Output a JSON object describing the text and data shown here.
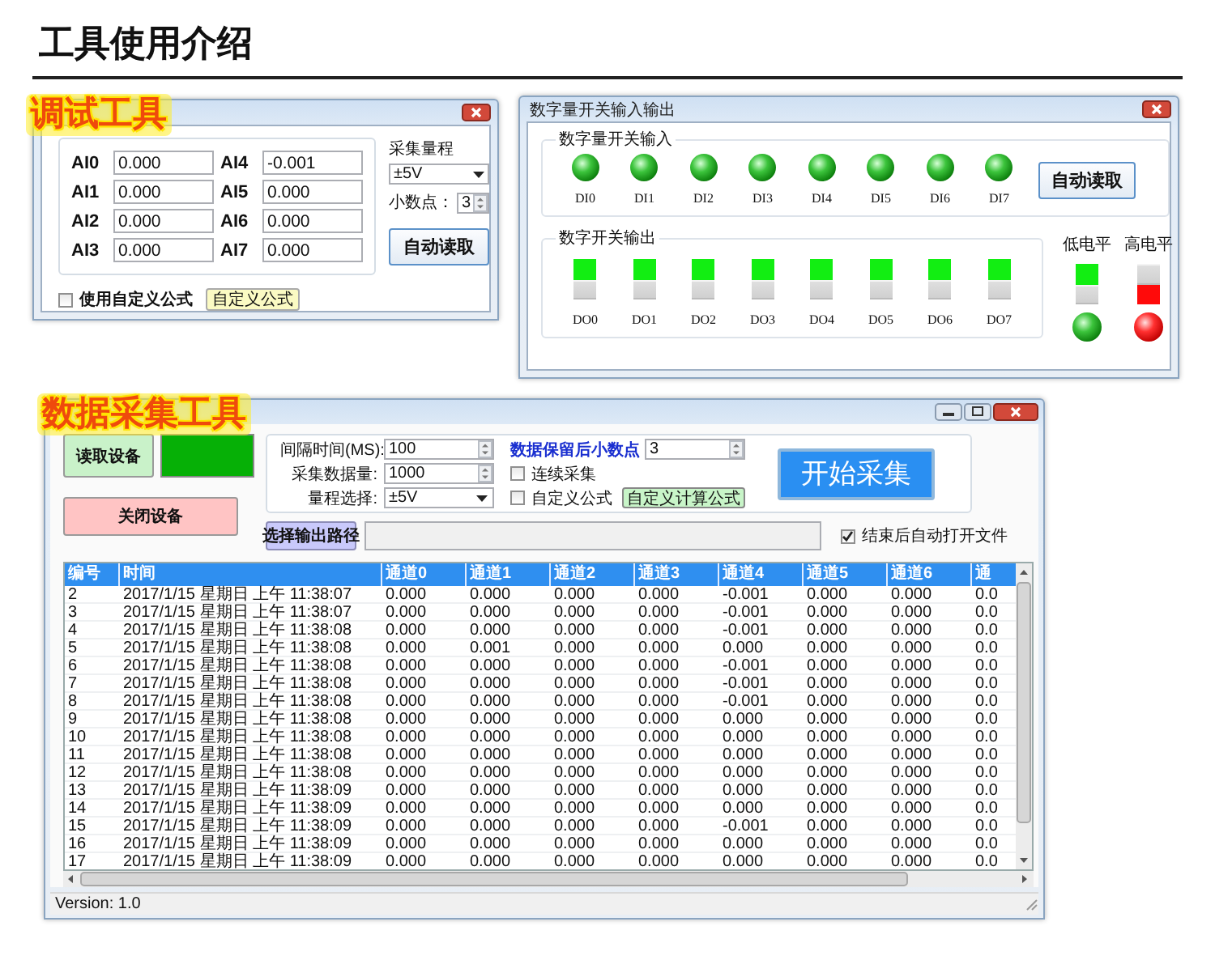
{
  "page_title": "工具使用介绍",
  "debug_tool": {
    "badge": "调试工具",
    "channels": [
      {
        "label": "AI0",
        "value": "0.000"
      },
      {
        "label": "AI4",
        "value": "-0.001"
      },
      {
        "label": "AI1",
        "value": "0.000"
      },
      {
        "label": "AI5",
        "value": "0.000"
      },
      {
        "label": "AI2",
        "value": "0.000"
      },
      {
        "label": "AI6",
        "value": "0.000"
      },
      {
        "label": "AI3",
        "value": "0.000"
      },
      {
        "label": "AI7",
        "value": "0.000"
      }
    ],
    "range": {
      "label": "采集量程",
      "value": "±5V"
    },
    "decimals": {
      "label": "小数点：",
      "value": "3"
    },
    "auto_read_button": "自动读取",
    "custom_formula": {
      "label": "使用自定义公式",
      "checked": false
    },
    "formula_button": "自定义公式"
  },
  "dio_window": {
    "title": "数字量开关输入输出",
    "inputs": {
      "title": "数字量开关输入",
      "channels": [
        {
          "label": "DI0",
          "on": true
        },
        {
          "label": "DI1",
          "on": true
        },
        {
          "label": "DI2",
          "on": true
        },
        {
          "label": "DI3",
          "on": true
        },
        {
          "label": "DI4",
          "on": true
        },
        {
          "label": "DI5",
          "on": true
        },
        {
          "label": "DI6",
          "on": true
        },
        {
          "label": "DI7",
          "on": true
        }
      ]
    },
    "auto_read_button": "自动读取",
    "outputs": {
      "title": "数字开关输出",
      "channels": [
        {
          "label": "DO0",
          "high": false
        },
        {
          "label": "DO1",
          "high": false
        },
        {
          "label": "DO2",
          "high": false
        },
        {
          "label": "DO3",
          "high": false
        },
        {
          "label": "DO4",
          "high": false
        },
        {
          "label": "DO5",
          "high": false
        },
        {
          "label": "DO6",
          "high": false
        },
        {
          "label": "DO7",
          "high": false
        }
      ]
    },
    "legend": [
      {
        "label": "低电平",
        "high": false
      },
      {
        "label": "高电平",
        "high": true
      }
    ]
  },
  "daq_tool": {
    "badge": "数据采集工具",
    "open_button": "读取设备",
    "device_connected": true,
    "close_button": "关闭设备",
    "interval": {
      "label": "间隔时间(MS):",
      "value": "100"
    },
    "count": {
      "label": "采集数据量:",
      "value": "1000"
    },
    "range": {
      "label": "量程选择:",
      "value": "±5V"
    },
    "decimals": {
      "label": "数据保留后小数点",
      "value": "3"
    },
    "continuous": {
      "label": "连续采集",
      "checked": false
    },
    "custom_formula": {
      "label": "自定义公式",
      "checked": false
    },
    "formula_button": "自定义计算公式",
    "start_button": "开始采集",
    "path_button": "选择输出路径",
    "open_after": {
      "label": "结束后自动打开文件",
      "checked": true
    },
    "table": {
      "columns": [
        "编号",
        "时间",
        "通道0",
        "通道1",
        "通道2",
        "通道3",
        "通道4",
        "通道5",
        "通道6",
        "通"
      ],
      "rows": [
        [
          "2",
          "2017/1/15 星期日 上午 11:38:07",
          "0.000",
          "0.000",
          "0.000",
          "0.000",
          "-0.001",
          "0.000",
          "0.000",
          "0.0"
        ],
        [
          "3",
          "2017/1/15 星期日 上午 11:38:07",
          "0.000",
          "0.000",
          "0.000",
          "0.000",
          "-0.001",
          "0.000",
          "0.000",
          "0.0"
        ],
        [
          "4",
          "2017/1/15 星期日 上午 11:38:08",
          "0.000",
          "0.000",
          "0.000",
          "0.000",
          "-0.001",
          "0.000",
          "0.000",
          "0.0"
        ],
        [
          "5",
          "2017/1/15 星期日 上午 11:38:08",
          "0.000",
          "0.001",
          "0.000",
          "0.000",
          "0.000",
          "0.000",
          "0.000",
          "0.0"
        ],
        [
          "6",
          "2017/1/15 星期日 上午 11:38:08",
          "0.000",
          "0.000",
          "0.000",
          "0.000",
          "-0.001",
          "0.000",
          "0.000",
          "0.0"
        ],
        [
          "7",
          "2017/1/15 星期日 上午 11:38:08",
          "0.000",
          "0.000",
          "0.000",
          "0.000",
          "-0.001",
          "0.000",
          "0.000",
          "0.0"
        ],
        [
          "8",
          "2017/1/15 星期日 上午 11:38:08",
          "0.000",
          "0.000",
          "0.000",
          "0.000",
          "-0.001",
          "0.000",
          "0.000",
          "0.0"
        ],
        [
          "9",
          "2017/1/15 星期日 上午 11:38:08",
          "0.000",
          "0.000",
          "0.000",
          "0.000",
          "0.000",
          "0.000",
          "0.000",
          "0.0"
        ],
        [
          "10",
          "2017/1/15 星期日 上午 11:38:08",
          "0.000",
          "0.000",
          "0.000",
          "0.000",
          "0.000",
          "0.000",
          "0.000",
          "0.0"
        ],
        [
          "11",
          "2017/1/15 星期日 上午 11:38:08",
          "0.000",
          "0.000",
          "0.000",
          "0.000",
          "0.000",
          "0.000",
          "0.000",
          "0.0"
        ],
        [
          "12",
          "2017/1/15 星期日 上午 11:38:08",
          "0.000",
          "0.000",
          "0.000",
          "0.000",
          "0.000",
          "0.000",
          "0.000",
          "0.0"
        ],
        [
          "13",
          "2017/1/15 星期日 上午 11:38:09",
          "0.000",
          "0.000",
          "0.000",
          "0.000",
          "0.000",
          "0.000",
          "0.000",
          "0.0"
        ],
        [
          "14",
          "2017/1/15 星期日 上午 11:38:09",
          "0.000",
          "0.000",
          "0.000",
          "0.000",
          "0.000",
          "0.000",
          "0.000",
          "0.0"
        ],
        [
          "15",
          "2017/1/15 星期日 上午 11:38:09",
          "0.000",
          "0.000",
          "0.000",
          "0.000",
          "-0.001",
          "0.000",
          "0.000",
          "0.0"
        ],
        [
          "16",
          "2017/1/15 星期日 上午 11:38:09",
          "0.000",
          "0.000",
          "0.000",
          "0.000",
          "0.000",
          "0.000",
          "0.000",
          "0.0"
        ],
        [
          "17",
          "2017/1/15 星期日 上午 11:38:09",
          "0.000",
          "0.000",
          "0.000",
          "0.000",
          "0.000",
          "0.000",
          "0.000",
          "0.0"
        ]
      ]
    },
    "status_bar": "Version: 1.0"
  }
}
